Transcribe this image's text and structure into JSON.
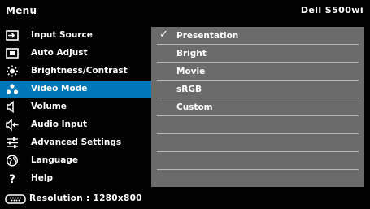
{
  "header": {
    "title": "Menu",
    "model": "Dell S500wi"
  },
  "menu": {
    "items": [
      {
        "label": "Input Source",
        "icon": "input-source-icon"
      },
      {
        "label": "Auto Adjust",
        "icon": "auto-adjust-icon"
      },
      {
        "label": "Brightness/Contrast",
        "icon": "brightness-icon"
      },
      {
        "label": "Video Mode",
        "icon": "video-mode-icon",
        "selected": true
      },
      {
        "label": "Volume",
        "icon": "volume-icon"
      },
      {
        "label": "Audio Input",
        "icon": "audio-input-icon"
      },
      {
        "label": "Advanced Settings",
        "icon": "advanced-settings-icon"
      },
      {
        "label": "Language",
        "icon": "language-icon"
      },
      {
        "label": "Help",
        "icon": "help-icon"
      }
    ]
  },
  "video_mode": {
    "check": "✓",
    "options": [
      {
        "label": "Presentation",
        "checked": true
      },
      {
        "label": "Bright"
      },
      {
        "label": "Movie"
      },
      {
        "label": "sRGB"
      },
      {
        "label": "Custom"
      },
      {
        "label": ""
      },
      {
        "label": ""
      },
      {
        "label": ""
      },
      {
        "label": ""
      }
    ]
  },
  "footer": {
    "resolution": "Resolution : 1280x800"
  },
  "colors": {
    "selected": "#0077b8",
    "panel": "#6b6b6b",
    "text": "#ffffff"
  }
}
